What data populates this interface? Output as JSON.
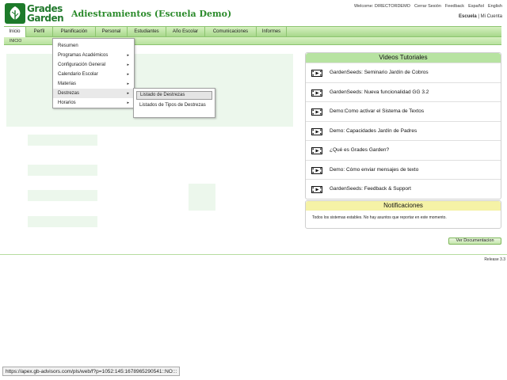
{
  "header": {
    "logo_line1": "Grades",
    "logo_line2": "Garden",
    "app_title": "Adiestramientos (Escuela Demo)",
    "top_links": [
      "Welcome: DIRECTORDEMO",
      "Cerrar Sesión",
      "Feedback",
      "Español",
      "English"
    ],
    "school_label": "Escuela",
    "my_account": "Mi Cuenta"
  },
  "nav": {
    "tabs": [
      "Inicio",
      "Perfil",
      "Planificación",
      "Personal",
      "Estudiantes",
      "Año Escolar",
      "Comunicaciones",
      "Informes"
    ],
    "sub_breadcrumb": "INICIO"
  },
  "planificacion_menu": {
    "items": [
      {
        "label": "Resumen",
        "has_submenu": false
      },
      {
        "label": "Programas Académicos",
        "has_submenu": true
      },
      {
        "label": "Configuración General",
        "has_submenu": true
      },
      {
        "label": "Calendario Escolar",
        "has_submenu": true
      },
      {
        "label": "Materias",
        "has_submenu": true
      },
      {
        "label": "Destrezas",
        "has_submenu": true
      },
      {
        "label": "Horarios",
        "has_submenu": true
      }
    ],
    "arrow": "▸"
  },
  "destrezas_submenu": {
    "items": [
      "Listado de Destrezas",
      "Listados de Tipos de Destrezas"
    ]
  },
  "videos": {
    "title": "Videos Tutoriales",
    "header_color": "#b7e3a1",
    "items": [
      "GardenSeeds: Seminario Jardín de Cobros",
      "GardenSeeds: Nueva funcionalidad GG 3.2",
      "Demo:Como activar el Sistema de Textos",
      "Demo: Capacidades Jardín de Padres",
      "¿Qué es Grades Garden?",
      "Demo: Cómo enviar mensajes de texto",
      "GardenSeeds: Feedback & Support"
    ]
  },
  "notifications": {
    "title": "Notificaciones",
    "header_color": "#f5f2a6",
    "message": "Todos los sistemas estables. No hay asuntos que reportar en este momento."
  },
  "doc_button": "Ver Documentacion",
  "release": "Release 3.3",
  "status_url": "https://apex.gb-advisors.com/pls/web/f?p=1052:145:1678965290541::NO:::"
}
